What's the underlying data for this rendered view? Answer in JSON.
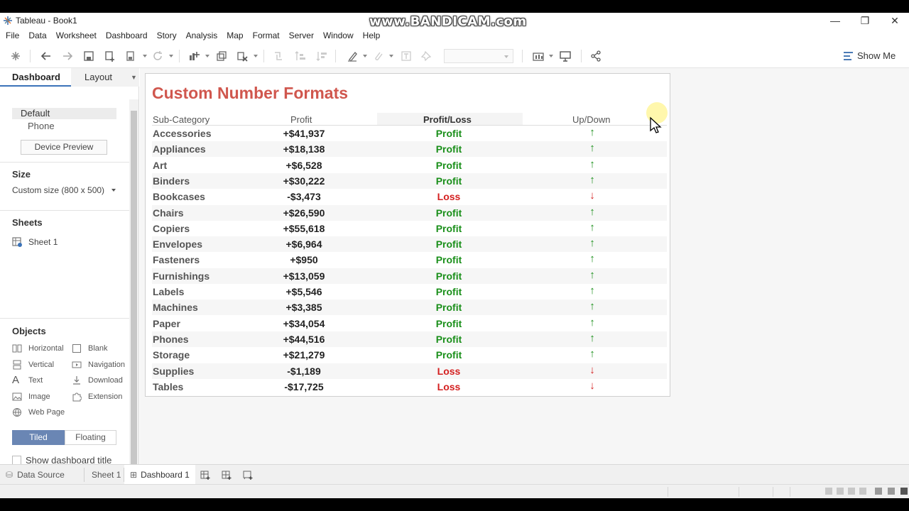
{
  "window": {
    "title": "Tableau - Book1",
    "watermark": "www.BANDICAM.com",
    "controls": {
      "minimize": "—",
      "restore": "❐",
      "close": "✕"
    }
  },
  "menu": [
    "File",
    "Data",
    "Worksheet",
    "Dashboard",
    "Story",
    "Analysis",
    "Map",
    "Format",
    "Server",
    "Window",
    "Help"
  ],
  "toolbar": {
    "show_me": "Show Me"
  },
  "side_panel": {
    "tabs": {
      "dashboard": "Dashboard",
      "layout": "Layout"
    },
    "devices": {
      "default": "Default",
      "phone": "Phone",
      "preview_button": "Device Preview"
    },
    "size": {
      "title": "Size",
      "value": "Custom size (800 x 500)"
    },
    "sheets": {
      "title": "Sheets",
      "items": [
        "Sheet 1"
      ]
    },
    "objects": {
      "title": "Objects",
      "items": [
        "Horizontal",
        "Blank",
        "Vertical",
        "Navigation",
        "Text",
        "Download",
        "Image",
        "Extension",
        "Web Page"
      ]
    },
    "layout_mode": {
      "tiled": "Tiled",
      "floating": "Floating"
    },
    "show_title": "Show dashboard title"
  },
  "dashboard": {
    "title": "Custom Number Formats",
    "columns": [
      "Sub-Category",
      "Profit",
      "Profit/Loss",
      "Up/Down"
    ],
    "rows": [
      {
        "sub": "Accessories",
        "profit": "+$41,937",
        "pl": "Profit",
        "arrow": "↑"
      },
      {
        "sub": "Appliances",
        "profit": "+$18,138",
        "pl": "Profit",
        "arrow": "↑"
      },
      {
        "sub": "Art",
        "profit": "+$6,528",
        "pl": "Profit",
        "arrow": "↑"
      },
      {
        "sub": "Binders",
        "profit": "+$30,222",
        "pl": "Profit",
        "arrow": "↑"
      },
      {
        "sub": "Bookcases",
        "profit": "-$3,473",
        "pl": "Loss",
        "arrow": "↓"
      },
      {
        "sub": "Chairs",
        "profit": "+$26,590",
        "pl": "Profit",
        "arrow": "↑"
      },
      {
        "sub": "Copiers",
        "profit": "+$55,618",
        "pl": "Profit",
        "arrow": "↑"
      },
      {
        "sub": "Envelopes",
        "profit": "+$6,964",
        "pl": "Profit",
        "arrow": "↑"
      },
      {
        "sub": "Fasteners",
        "profit": "+$950",
        "pl": "Profit",
        "arrow": "↑"
      },
      {
        "sub": "Furnishings",
        "profit": "+$13,059",
        "pl": "Profit",
        "arrow": "↑"
      },
      {
        "sub": "Labels",
        "profit": "+$5,546",
        "pl": "Profit",
        "arrow": "↑"
      },
      {
        "sub": "Machines",
        "profit": "+$3,385",
        "pl": "Profit",
        "arrow": "↑"
      },
      {
        "sub": "Paper",
        "profit": "+$34,054",
        "pl": "Profit",
        "arrow": "↑"
      },
      {
        "sub": "Phones",
        "profit": "+$44,516",
        "pl": "Profit",
        "arrow": "↑"
      },
      {
        "sub": "Storage",
        "profit": "+$21,279",
        "pl": "Profit",
        "arrow": "↑"
      },
      {
        "sub": "Supplies",
        "profit": "-$1,189",
        "pl": "Loss",
        "arrow": "↓"
      },
      {
        "sub": "Tables",
        "profit": "-$17,725",
        "pl": "Loss",
        "arrow": "↓"
      }
    ]
  },
  "colors": {
    "title": "#d0574e",
    "profit": "#1a8f1a",
    "loss": "#d42020",
    "accent": "#3b73b9",
    "tiled": "#6a86b4"
  },
  "tabs": {
    "data_source": "Data Source",
    "sheet1": "Sheet 1",
    "dashboard1": "Dashboard 1"
  }
}
